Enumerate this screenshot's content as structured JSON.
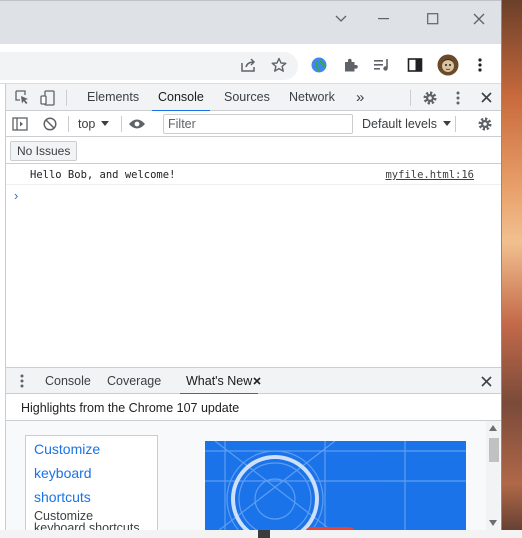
{
  "devtools": {
    "main_tabs": [
      "Elements",
      "Console",
      "Sources",
      "Network"
    ],
    "overflow_label": "»",
    "console_toolbar": {
      "context": "top",
      "filter_placeholder": "Filter",
      "levels": "Default levels"
    },
    "issues_label": "No Issues",
    "console": {
      "message": "Hello Bob, and welcome!",
      "source": "myfile.html:16",
      "prompt": "›"
    },
    "drawer": {
      "tabs": [
        "Console",
        "Coverage",
        "What's New"
      ],
      "whats_new_header": "Highlights from the Chrome 107 update",
      "toc_links": [
        "Customize",
        "keyboard",
        "shortcuts"
      ],
      "toc_text": [
        "Customize",
        "keyboard shortcuts"
      ]
    }
  },
  "icons": {
    "window": [
      "chevron-down-icon",
      "minimize-icon",
      "maximize-icon",
      "close-icon"
    ],
    "toolbar": [
      "share-icon",
      "bookmark-star-icon",
      "extension-globe-icon",
      "extensions-puzzle-icon",
      "media-queue-icon",
      "side-panel-icon",
      "avatar",
      "menu-dots-icon"
    ]
  },
  "colors": {
    "accent": "#1a73e8",
    "titlebar": "#dee1e6",
    "devtools_bar": "#f1f3f4"
  }
}
